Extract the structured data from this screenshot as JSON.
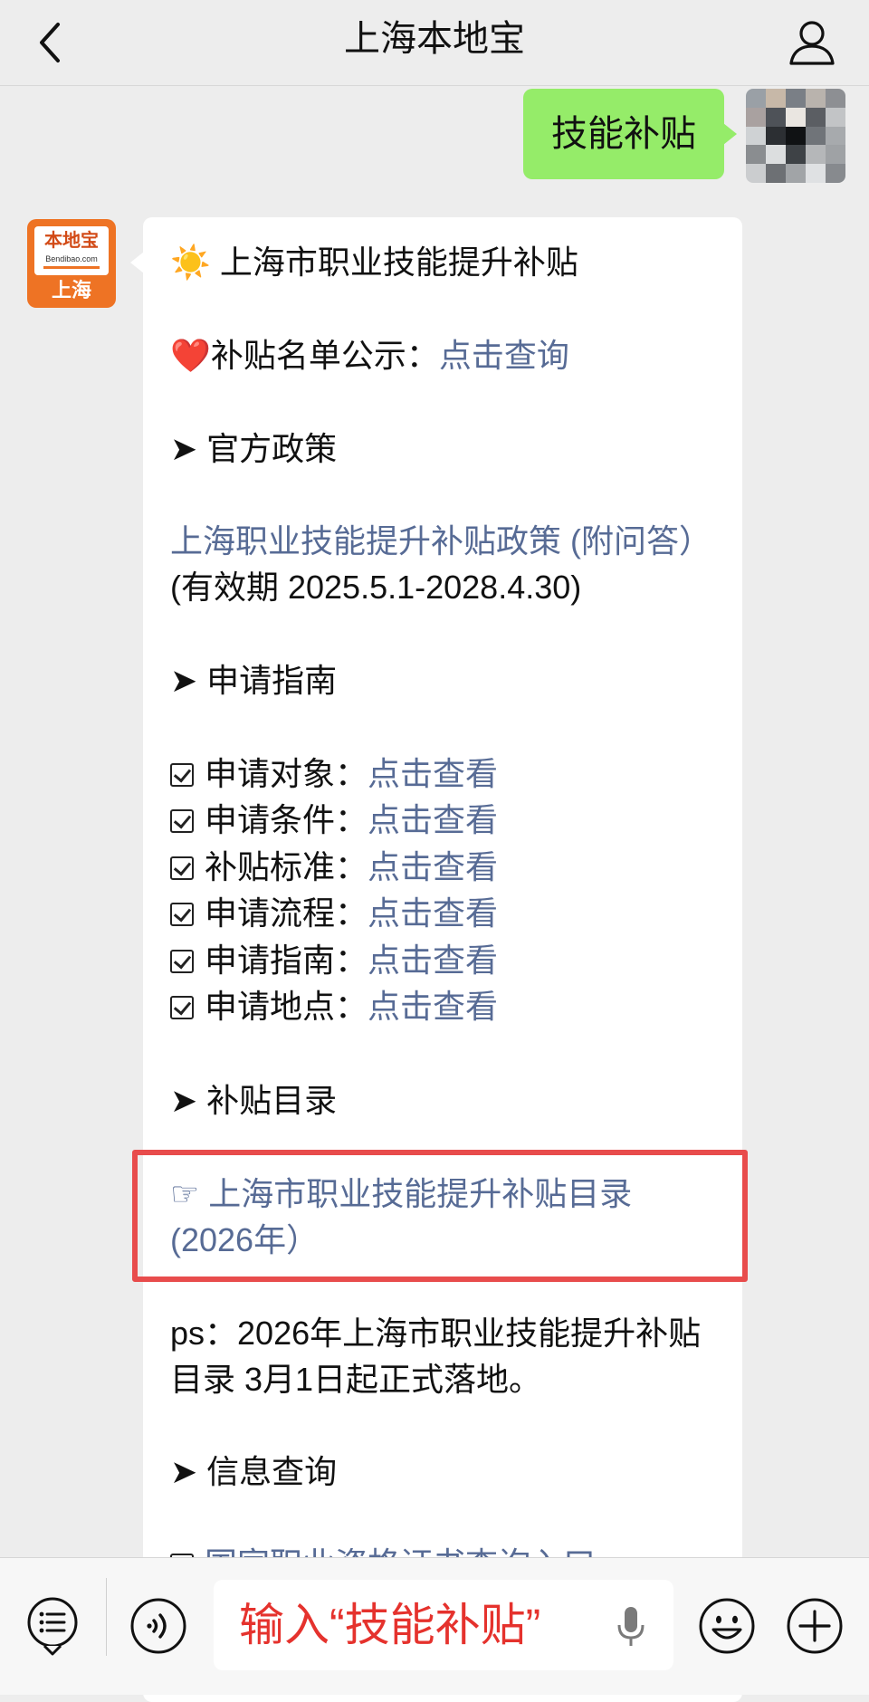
{
  "header": {
    "title": "上海本地宝",
    "back_icon": "chevron-left-icon",
    "user_icon": "person-icon"
  },
  "chat": {
    "outgoing": {
      "text": "技能补贴"
    },
    "bot_avatar": {
      "brand": "本地宝",
      "url": "Bendibao.com",
      "city": "上海"
    },
    "incoming": {
      "title": "上海市职业技能提升补贴",
      "title_emoji": "☀️",
      "publicity_emoji": "❤️",
      "publicity_label": "补贴名单公示：",
      "publicity_link": "点击查询",
      "section_policy": "➤ 官方政策",
      "policy_link": "上海职业技能提升补贴政策 (附问答）",
      "policy_validity": "(有效期 2025.5.1-2028.4.30)",
      "section_guide": "➤ 申请指南",
      "guide_items": [
        {
          "label": "申请对象：",
          "link": "点击查看"
        },
        {
          "label": "申请条件：",
          "link": "点击查看"
        },
        {
          "label": "补贴标准：",
          "link": "点击查看"
        },
        {
          "label": "申请流程：",
          "link": "点击查看"
        },
        {
          "label": "申请指南：",
          "link": "点击查看"
        },
        {
          "label": "申请地点：",
          "link": "点击查看"
        }
      ],
      "section_catalog": "➤ 补贴目录",
      "catalog_pointer": "☞",
      "catalog_link": "上海市职业技能提升补贴目录(2026年）",
      "ps_note": "ps：2026年上海市职业技能提升补贴目录 3月1日起正式落地。",
      "section_query": "➤ 信息查询",
      "query_partial": "国家职业资格证书查询入口"
    },
    "highlight_color": "#e84c4c"
  },
  "bottom_bar": {
    "menu_icon": "menu-list-icon",
    "voice_icon": "voice-icon",
    "input_text": "输入“技能补贴”",
    "mic_icon": "microphone-icon",
    "emoji_icon": "emoji-icon",
    "plus_icon": "plus-icon"
  },
  "colors": {
    "link": "#576b95",
    "bubble_out": "#95ec69",
    "background": "#ededed"
  }
}
